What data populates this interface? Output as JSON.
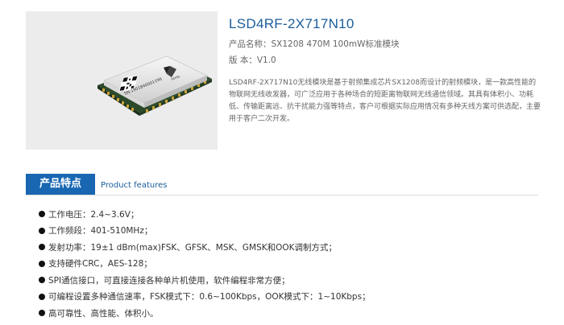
{
  "product": {
    "title": "LSD4RF-2X717N10",
    "name_line": "产品名称：SX1208 470M 100mW标准模块",
    "version_line": "版 本：V1.0",
    "description": "LSD4RF-2X717N10无线模块是基于射频集成芯片SX1208而设计的射频模块，是一款高性能的物联网无线收发器，可广泛应用于各种场合的短距离物联网无线通信领域。其具有体积小、功耗低、传输距离远、抗干扰能力强等特点，客户可根据实际应用情况有多种天线方案可供选配，主要用于客户二次开发。",
    "image": {
      "serial": "SN:1901840001196",
      "brand": "lierda"
    }
  },
  "section": {
    "title_cn": "产品特点",
    "title_en": "Product features"
  },
  "features": [
    "工作电压：2.4~3.6V；",
    "工作频段：401-510MHz；",
    "发射功率：19±1 dBm(max)FSK、GFSK、MSK、GMSK和OOK调制方式；",
    "支持硬件CRC，AES-128；",
    "SPI通信接口，可直接连接各种单片机使用，软件编程非常方便；",
    "可编程设置多种通信速率，FSK模式下：0.6~100Kbps，OOK模式下：1~10Kbps；",
    "高可靠性、高性能、体积小。"
  ]
}
